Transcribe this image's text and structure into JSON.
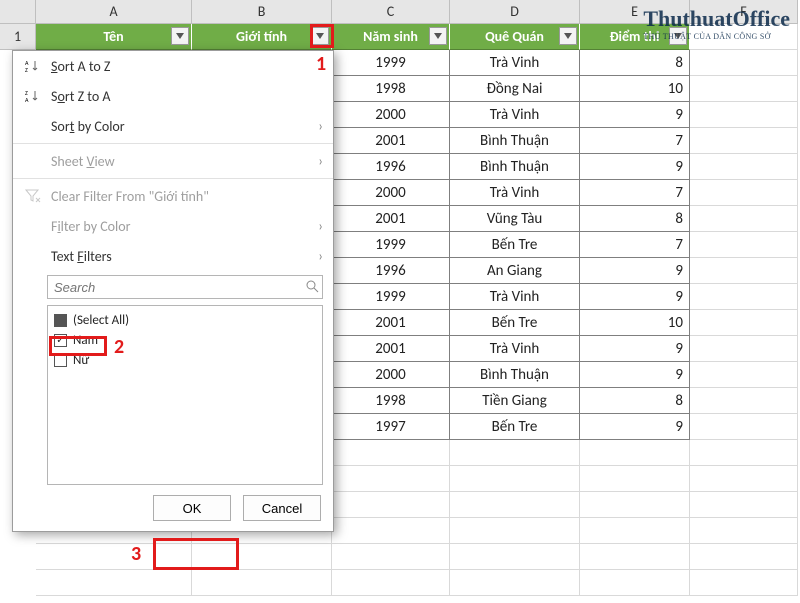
{
  "columns": [
    {
      "letter": "A",
      "width": 156
    },
    {
      "letter": "B",
      "width": 140
    },
    {
      "letter": "C",
      "width": 118
    },
    {
      "letter": "D",
      "width": 130
    },
    {
      "letter": "E",
      "width": 110
    },
    {
      "letter": "F",
      "width": 108
    }
  ],
  "row_header_visible": "1",
  "headers": {
    "A": "Tên",
    "B": "Giới tính",
    "C": "Năm sinh",
    "D": "Quê Quán",
    "E": "Điểm thi"
  },
  "rows": [
    {
      "year": "1999",
      "province": "Trà Vinh",
      "score": "8"
    },
    {
      "year": "1998",
      "province": "Đồng Nai",
      "score": "10"
    },
    {
      "year": "2000",
      "province": "Trà Vinh",
      "score": "9"
    },
    {
      "year": "2001",
      "province": "Bình Thuận",
      "score": "7"
    },
    {
      "year": "1996",
      "province": "Bình Thuận",
      "score": "9"
    },
    {
      "year": "2000",
      "province": "Trà Vinh",
      "score": "7"
    },
    {
      "year": "2001",
      "province": "Vũng Tàu",
      "score": "8"
    },
    {
      "year": "1999",
      "province": "Bến Tre",
      "score": "7"
    },
    {
      "year": "1996",
      "province": "An Giang",
      "score": "9"
    },
    {
      "year": "1999",
      "province": "Trà Vinh",
      "score": "9"
    },
    {
      "year": "2001",
      "province": "Bến Tre",
      "score": "10"
    },
    {
      "year": "2001",
      "province": "Trà Vinh",
      "score": "9"
    },
    {
      "year": "2000",
      "province": "Bình Thuận",
      "score": "9"
    },
    {
      "year": "1998",
      "province": "Tiền Giang",
      "score": "8"
    },
    {
      "year": "1997",
      "province": "Bến Tre",
      "score": "9"
    }
  ],
  "filter_menu": {
    "sort_az": "Sort A to Z",
    "sort_za": "Sort Z to A",
    "sort_by_color": "Sort by Color",
    "sheet_view": "Sheet View",
    "clear_filter": "Clear Filter From \"Giới tính\"",
    "filter_by_color": "Filter by Color",
    "text_filters": "Text Filters",
    "search_placeholder": "Search",
    "select_all": "(Select All)",
    "option1": "Nam",
    "option2": "Nữ",
    "ok": "OK",
    "cancel": "Cancel"
  },
  "callouts": {
    "c1": "1",
    "c2": "2",
    "c3": "3"
  },
  "watermark": {
    "line1": "ThuthuatOffice",
    "line2": "THỦ THUẬT CỦA DÂN CÔNG SỞ"
  }
}
